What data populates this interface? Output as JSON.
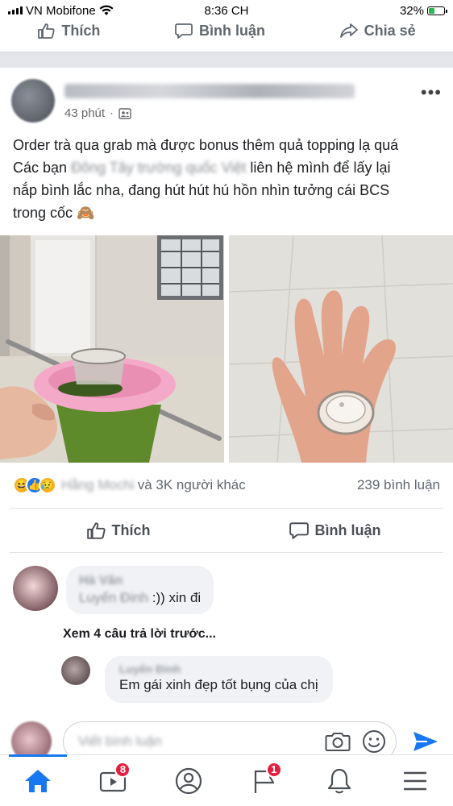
{
  "status_bar": {
    "carrier": "VN Mobifone",
    "time": "8:36 CH",
    "battery": "32%"
  },
  "prev_post_actions": {
    "like": "Thích",
    "comment": "Bình luận",
    "share": "Chia sẻ"
  },
  "post": {
    "time_ago": "43 phút",
    "dot": "·",
    "text_line1": "Order trà qua grab mà được bonus thêm quả topping lạ quá",
    "text_line2_start": "Các bạn",
    "text_line2_blurred": "Đông Tây trường quốc Việt",
    "text_line2_end": "liên hệ mình để lấy lại",
    "text_line3": "nắp bình lắc nha, đang hút hút hú hồn nhìn tưởng cái BCS",
    "text_line4": "trong cốc",
    "emoji": "🙈"
  },
  "reactions": {
    "names_blurred": "Hằng Mochi",
    "others": "và 3K người khác",
    "comments_count": "239 bình luận"
  },
  "actions": {
    "like": "Thích",
    "comment": "Bình luận"
  },
  "comment": {
    "name_blurred": "Hà Vân",
    "mention_blurred": "Luyến Đinh",
    "text": ":)) xin đi"
  },
  "view_replies": "Xem 4 câu trả lời trước...",
  "reply": {
    "name_blurred": "Luyến Đinh",
    "text": "Em gái xinh đẹp tốt bụng của chị"
  },
  "compose": {
    "placeholder_blurred": "Viết bình luận"
  },
  "tabbar": {
    "video_badge": "8",
    "notifications_badge": "1"
  },
  "colors": {
    "accent": "#1877f2",
    "badge": "#e41e3f",
    "battery": "#2db84c"
  }
}
